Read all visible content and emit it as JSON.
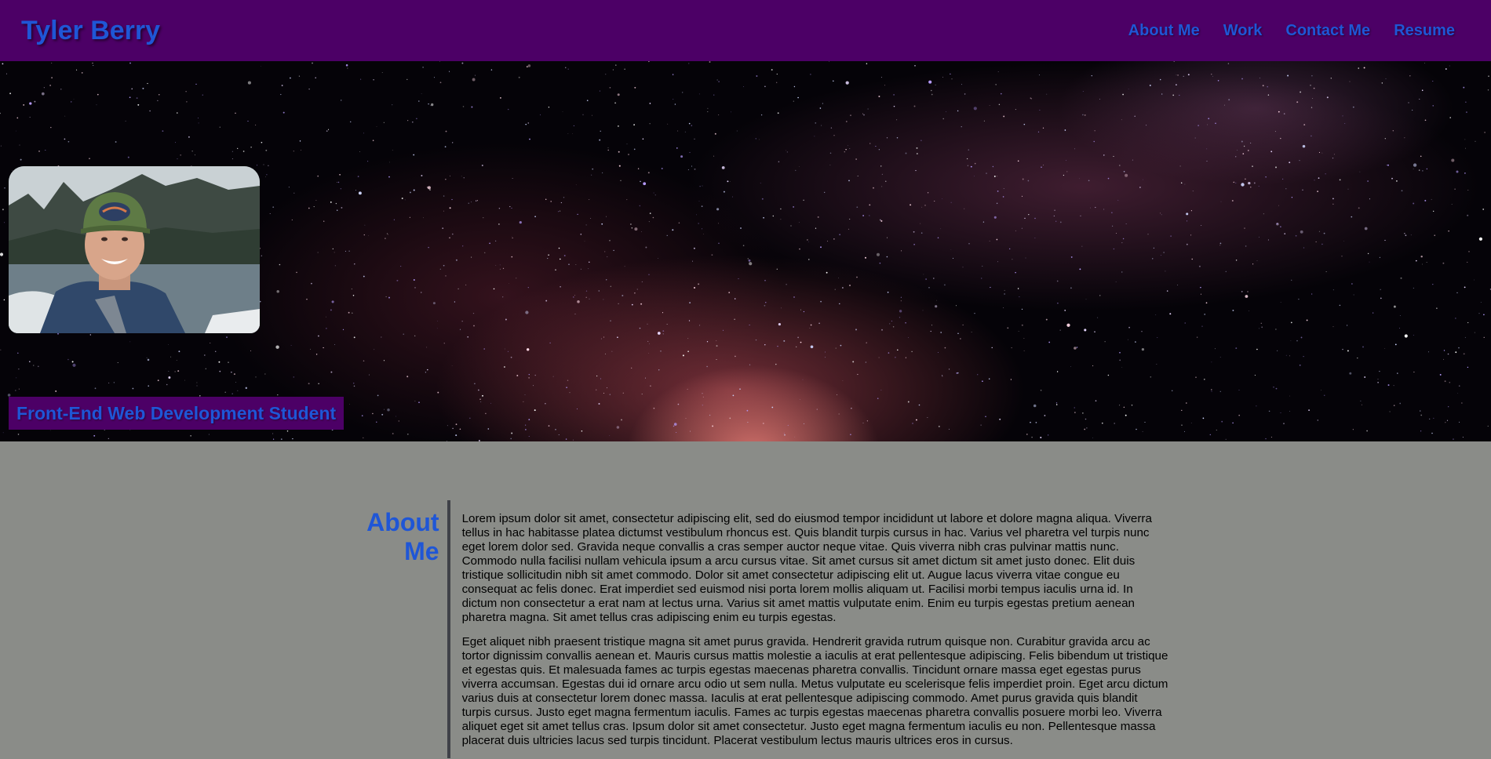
{
  "header": {
    "title": "Tyler Berry",
    "nav": [
      {
        "label": "About Me"
      },
      {
        "label": "Work"
      },
      {
        "label": "Contact Me"
      },
      {
        "label": "Resume"
      }
    ]
  },
  "hero": {
    "photo_icon": "profile-photo",
    "tagline": "Front-End Web Development Student"
  },
  "about": {
    "heading_line1": "About",
    "heading_line2": "Me",
    "paragraphs": [
      "Lorem ipsum dolor sit amet, consectetur adipiscing elit, sed do eiusmod tempor incididunt ut labore et dolore magna aliqua. Viverra tellus in hac habitasse platea dictumst vestibulum rhoncus est. Quis blandit turpis cursus in hac. Varius vel pharetra vel turpis nunc eget lorem dolor sed. Gravida neque convallis a cras semper auctor neque vitae. Quis viverra nibh cras pulvinar mattis nunc. Commodo nulla facilisi nullam vehicula ipsum a arcu cursus vitae. Sit amet cursus sit amet dictum sit amet justo donec. Elit duis tristique sollicitudin nibh sit amet commodo. Dolor sit amet consectetur adipiscing elit ut. Augue lacus viverra vitae congue eu consequat ac felis donec. Erat imperdiet sed euismod nisi porta lorem mollis aliquam ut. Facilisi morbi tempus iaculis urna id. In dictum non consectetur a erat nam at lectus urna. Varius sit amet mattis vulputate enim. Enim eu turpis egestas pretium aenean pharetra magna. Sit amet tellus cras adipiscing enim eu turpis egestas.",
      "Eget aliquet nibh praesent tristique magna sit amet purus gravida. Hendrerit gravida rutrum quisque non. Curabitur gravida arcu ac tortor dignissim convallis aenean et. Mauris cursus mattis molestie a iaculis at erat pellentesque adipiscing. Felis bibendum ut tristique et egestas quis. Et malesuada fames ac turpis egestas maecenas pharetra convallis. Tincidunt ornare massa eget egestas purus viverra accumsan. Egestas dui id ornare arcu odio ut sem nulla. Metus vulputate eu scelerisque felis imperdiet proin. Eget arcu dictum varius duis at consectetur lorem donec massa. Iaculis at erat pellentesque adipiscing commodo. Amet purus gravida quis blandit turpis cursus. Justo eget magna fermentum iaculis. Fames ac turpis egestas maecenas pharetra convallis posuere morbi leo. Viverra aliquet eget sit amet tellus cras. Ipsum dolor sit amet consectetur. Justo eget magna fermentum iaculis eu non. Pellentesque massa placerat duis ultricies lacus sed turpis tincidunt. Placerat vestibulum lectus mauris ultrices eros in cursus."
    ]
  },
  "colors": {
    "header_bg": "#4c0066",
    "accent_text": "#1f56d6",
    "page_bg": "#8a8c88",
    "divider": "#3f4148"
  }
}
